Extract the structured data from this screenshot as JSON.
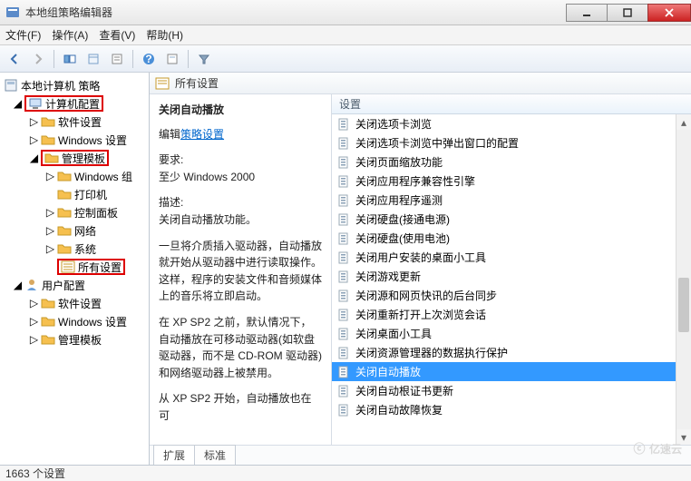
{
  "window": {
    "title": "本地组策略编辑器"
  },
  "menus": {
    "file": "文件(F)",
    "action": "操作(A)",
    "view": "查看(V)",
    "help": "帮助(H)"
  },
  "tree": {
    "root": "本地计算机 策略",
    "computer_config": "计算机配置",
    "software_settings": "软件设置",
    "windows_settings": "Windows 设置",
    "admin_templates": "管理模板",
    "windows_comp": "Windows 组",
    "printers": "打印机",
    "control_panel": "控制面板",
    "network": "网络",
    "system": "系统",
    "all_settings": "所有设置",
    "user_config": "用户配置",
    "software_settings2": "软件设置",
    "windows_settings2": "Windows 设置",
    "admin_templates2": "管理模板"
  },
  "panel": {
    "title": "所有设置",
    "heading": "关闭自动播放",
    "edit_prefix": "编辑",
    "edit_link": "策略设置",
    "req_label": "要求:",
    "req_value": "至少 Windows 2000",
    "desc_label": "描述:",
    "desc_line1": "关闭自动播放功能。",
    "desc_para1": "一旦将介质插入驱动器，自动播放就开始从驱动器中进行读取操作。这样，程序的安装文件和音频媒体上的音乐将立即启动。",
    "desc_para2": "在 XP SP2 之前，默认情况下，自动播放在可移动驱动器(如软盘驱动器，而不是 CD-ROM 驱动器)和网络驱动器上被禁用。",
    "desc_para3": "从 XP SP2 开始，自动播放也在可"
  },
  "list": {
    "header": "设置",
    "items": [
      "关闭选项卡浏览",
      "关闭选项卡浏览中弹出窗口的配置",
      "关闭页面缩放功能",
      "关闭应用程序兼容性引擎",
      "关闭应用程序遥测",
      "关闭硬盘(接通电源)",
      "关闭硬盘(使用电池)",
      "关闭用户安装的桌面小工具",
      "关闭游戏更新",
      "关闭源和网页快讯的后台同步",
      "关闭重新打开上次浏览会话",
      "关闭桌面小工具",
      "关闭资源管理器的数据执行保护",
      "关闭自动播放",
      "关闭自动根证书更新",
      "关闭自动故障恢复"
    ],
    "selected_index": 13
  },
  "tabs": {
    "extended": "扩展",
    "standard": "标准"
  },
  "status": "1663 个设置",
  "watermark": "亿速云"
}
